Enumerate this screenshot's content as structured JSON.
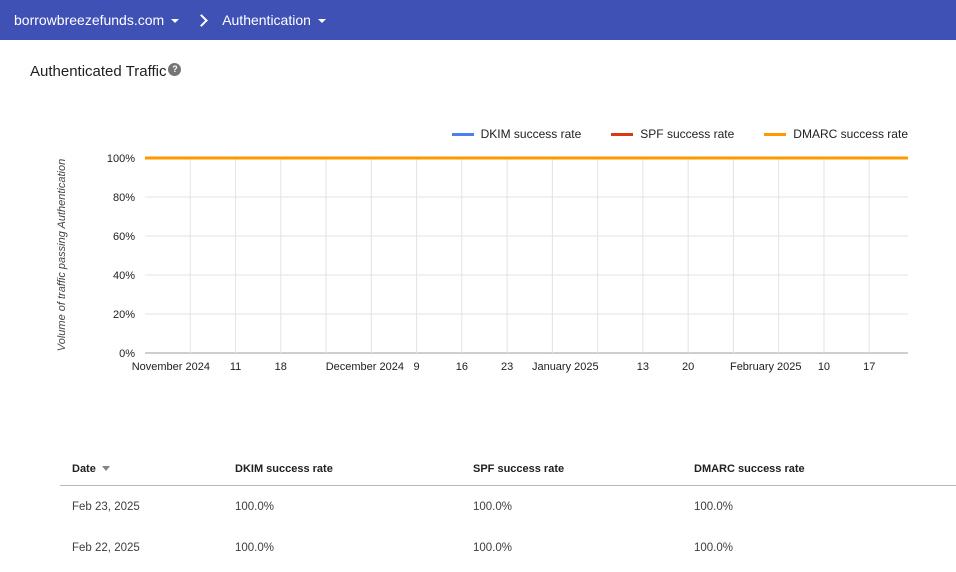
{
  "colors": {
    "topbar_bg": "#3f51b5"
  },
  "topbar": {
    "domain_label": "borrowbreezefunds.com",
    "section_label": "Authentication"
  },
  "page": {
    "title": "Authenticated Traffic",
    "help_icon": "?"
  },
  "chart_data": {
    "type": "line",
    "title": "Authenticated Traffic",
    "xlabel": "",
    "ylabel": "Volume of traffic passing Authentication",
    "ylim": [
      0,
      100
    ],
    "grid": true,
    "legend_position": "top-right",
    "y_axis": {
      "min": 0,
      "max": 100,
      "ticks": [
        {
          "value": 0,
          "label": "0%"
        },
        {
          "value": 20,
          "label": "20%"
        },
        {
          "value": 40,
          "label": "40%"
        },
        {
          "value": 60,
          "label": "60%"
        },
        {
          "value": 80,
          "label": "80%"
        },
        {
          "value": 100,
          "label": "100%"
        }
      ]
    },
    "x_axis": {
      "span_days": 118,
      "week_ticks": [
        {
          "day": 7,
          "label": ""
        },
        {
          "day": 14,
          "label": "11"
        },
        {
          "day": 21,
          "label": "18"
        },
        {
          "day": 28,
          "label": ""
        },
        {
          "day": 35,
          "label": ""
        },
        {
          "day": 42,
          "label": "9"
        },
        {
          "day": 49,
          "label": "16"
        },
        {
          "day": 56,
          "label": "23"
        },
        {
          "day": 63,
          "label": ""
        },
        {
          "day": 70,
          "label": ""
        },
        {
          "day": 77,
          "label": "13"
        },
        {
          "day": 84,
          "label": "20"
        },
        {
          "day": 91,
          "label": ""
        },
        {
          "day": 98,
          "label": ""
        },
        {
          "day": 105,
          "label": "10"
        },
        {
          "day": 112,
          "label": "17"
        }
      ],
      "month_labels": [
        {
          "day": 4,
          "label": "November 2024"
        },
        {
          "day": 34,
          "label": "December 2024"
        },
        {
          "day": 65,
          "label": "January 2025"
        },
        {
          "day": 96,
          "label": "February 2025"
        }
      ]
    },
    "series": [
      {
        "name": "DKIM success rate",
        "color": "#4c80f1",
        "points": [
          {
            "day": 0,
            "value": 100
          },
          {
            "day": 118,
            "value": 100
          }
        ]
      },
      {
        "name": "SPF success rate",
        "color": "#dc3912",
        "points": [
          {
            "day": 0,
            "value": 100
          },
          {
            "day": 118,
            "value": 100
          }
        ]
      },
      {
        "name": "DMARC success rate",
        "color": "#ff9900",
        "points": [
          {
            "day": 0,
            "value": 100
          },
          {
            "day": 118,
            "value": 100
          }
        ]
      }
    ]
  },
  "table": {
    "columns": [
      "Date",
      "DKIM success rate",
      "SPF success rate",
      "DMARC success rate"
    ],
    "rows": [
      [
        "Feb 23, 2025",
        "100.0%",
        "100.0%",
        "100.0%"
      ],
      [
        "Feb 22, 2025",
        "100.0%",
        "100.0%",
        "100.0%"
      ]
    ]
  }
}
